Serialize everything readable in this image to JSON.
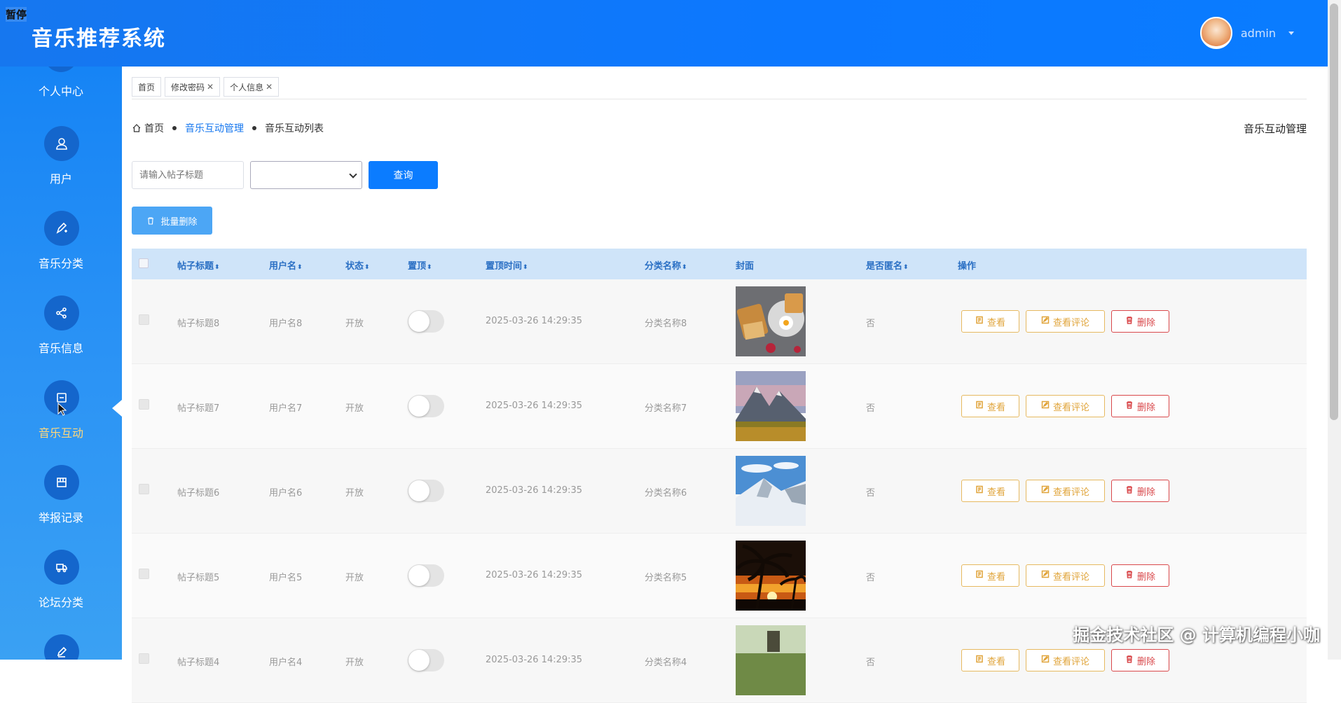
{
  "overlay": {
    "pause_label": "暂停",
    "watermark": "掘金技术社区 @ 计算机编程小咖"
  },
  "header": {
    "title": "音乐推荐系统",
    "username": "admin"
  },
  "sidebar": {
    "items": [
      {
        "label": "个人中心",
        "icon": "person-center-icon"
      },
      {
        "label": "用户",
        "icon": "user-icon"
      },
      {
        "label": "音乐分类",
        "icon": "edit-add-icon"
      },
      {
        "label": "音乐信息",
        "icon": "share-icon"
      },
      {
        "label": "音乐互动",
        "icon": "window-icon"
      },
      {
        "label": "举报记录",
        "icon": "report-icon"
      },
      {
        "label": "论坛分类",
        "icon": "truck-icon"
      },
      {
        "label": "",
        "icon": "pencil-icon"
      }
    ],
    "active_index": 4
  },
  "tabs": [
    {
      "label": "首页",
      "closable": false
    },
    {
      "label": "修改密码",
      "closable": true
    },
    {
      "label": "个人信息",
      "closable": true
    }
  ],
  "breadcrumb": {
    "home": "首页",
    "section": "音乐互动管理",
    "current": "音乐互动列表"
  },
  "page_heading": "音乐互动管理",
  "search": {
    "placeholder": "请输入帖子标题",
    "select_value": "",
    "query_label": "查询",
    "batch_delete_label": "批量删除"
  },
  "table": {
    "headers": {
      "title": "帖子标题",
      "username": "用户名",
      "status": "状态",
      "pinned": "置顶",
      "pin_time": "置顶时间",
      "category": "分类名称",
      "cover": "封面",
      "anonymous": "是否匿名",
      "actions": "操作"
    },
    "sort_glyph": "⬍",
    "action_labels": {
      "view": "查看",
      "comments": "查看评论",
      "delete": "删除"
    },
    "rows": [
      {
        "title": "帖子标题8",
        "username": "用户名8",
        "status": "开放",
        "pinned": false,
        "pin_time": "2025-03-26 14:29:35",
        "category": "分类名称8",
        "cover": "food",
        "anonymous": "否"
      },
      {
        "title": "帖子标题7",
        "username": "用户名7",
        "status": "开放",
        "pinned": false,
        "pin_time": "2025-03-26 14:29:35",
        "category": "分类名称7",
        "cover": "mountain-autumn",
        "anonymous": "否"
      },
      {
        "title": "帖子标题6",
        "username": "用户名6",
        "status": "开放",
        "pinned": false,
        "pin_time": "2025-03-26 14:29:35",
        "category": "分类名称6",
        "cover": "snow-mountain",
        "anonymous": "否"
      },
      {
        "title": "帖子标题5",
        "username": "用户名5",
        "status": "开放",
        "pinned": false,
        "pin_time": "2025-03-26 14:29:35",
        "category": "分类名称5",
        "cover": "palm-sunset",
        "anonymous": "否"
      },
      {
        "title": "帖子标题4",
        "username": "用户名4",
        "status": "开放",
        "pinned": false,
        "pin_time": "2025-03-26 14:29:35",
        "category": "分类名称4",
        "cover": "field",
        "anonymous": "否"
      }
    ]
  }
}
